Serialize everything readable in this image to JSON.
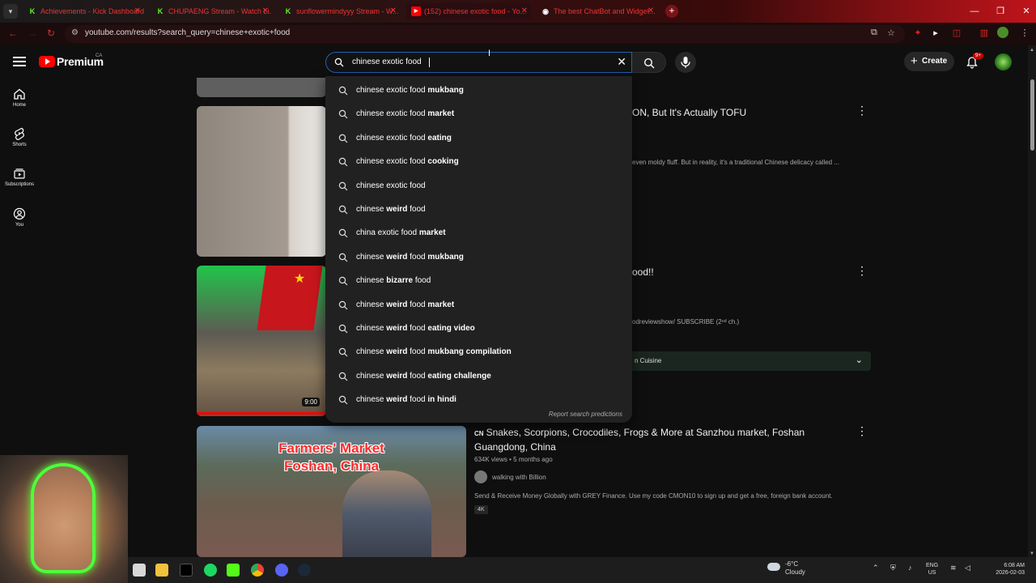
{
  "browser": {
    "tabs": [
      {
        "title": "Achievements - Kick Dashboard",
        "favicon": "kick-icon",
        "favicon_color": "#53fc18"
      },
      {
        "title": "CHUPAENG Stream - Watch Li...",
        "favicon": "kick-icon",
        "favicon_color": "#53fc18"
      },
      {
        "title": "sunflowermindyyy Stream - W...",
        "favicon": "kick-icon",
        "favicon_color": "#53fc18"
      },
      {
        "title": "(152) chinese exotic food - Yo...",
        "favicon": "youtube-icon",
        "favicon_color": "#ff0000"
      },
      {
        "title": "The best ChatBot and Widget...",
        "favicon": "botrix-icon",
        "favicon_color": "#ffffff"
      }
    ],
    "active_tab_index": 3,
    "url": "youtube.com/results?search_query=chinese+exotic+food"
  },
  "youtube": {
    "logo_text": "Premium",
    "country_code": "CA",
    "search_query": "chinese exotic food",
    "create_label": "Create",
    "notification_badge": "9+",
    "nav": [
      {
        "label": "Home",
        "icon": "home-icon"
      },
      {
        "label": "Shorts",
        "icon": "shorts-icon"
      },
      {
        "label": "Subscriptions",
        "icon": "subscriptions-icon"
      },
      {
        "label": "You",
        "icon": "you-icon"
      }
    ],
    "suggestions": [
      {
        "base": "chinese exotic food",
        "bold": " mukbang"
      },
      {
        "base": "chinese exotic food",
        "bold": " market"
      },
      {
        "base": "chinese exotic food",
        "bold": " eating"
      },
      {
        "base": "chinese exotic food",
        "bold": " cooking"
      },
      {
        "base": "chinese exotic food",
        "bold": ""
      },
      {
        "base": "chinese",
        "bold": " weird",
        "tail": " food"
      },
      {
        "base": "china",
        "bold": "",
        "tail": " exotic food",
        "bold2": " market"
      },
      {
        "base": "chinese",
        "bold": " weird",
        "tail": " food",
        "bold2": " mukbang"
      },
      {
        "base": "chinese",
        "bold": " bizarre",
        "tail": " food"
      },
      {
        "base": "chinese",
        "bold": " weird",
        "tail": " food",
        "bold2": " market"
      },
      {
        "base": "chinese",
        "bold": " weird",
        "tail": " food",
        "bold2": " eating video"
      },
      {
        "base": "chinese",
        "bold": " weird",
        "tail": " food",
        "bold2": " mukbang compilation"
      },
      {
        "base": "chinese",
        "bold": " weird",
        "tail": " food",
        "bold2": " eating challenge"
      },
      {
        "base": "chinese",
        "bold": " weird",
        "tail": " food",
        "bold2": " in hindi"
      }
    ],
    "report_label": "Report search predictions",
    "results": [
      {
        "title_visible": "ON, But It's Actually TOFU",
        "desc_visible": "even moldy fluff. But in reality, it's a traditional Chinese delicacy called ..."
      },
      {
        "title_visible": "ood!!",
        "desc_visible": "odreviewshow/ SUBSCRIBE (2ⁿᵈ ch.)",
        "duration": "9:00",
        "chapter_label": "n Cuisine"
      },
      {
        "country_badge": "CN",
        "title": "Snakes, Scorpions, Crocodiles, Frogs & More at Sanzhou market, Foshan Guangdong, China",
        "views": "634K views",
        "age": "5 months ago",
        "channel": "walking with Billion",
        "desc": "Send & Receive Money Globally with GREY Finance. Use my code CMON10 to sign up and get a free, foreign bank account.",
        "quality_badge": "4K",
        "thumb_text_1": "Farmers' Market",
        "thumb_text_2": "Foshan, China"
      }
    ]
  },
  "taskbar": {
    "weather_temp": "-6°C",
    "weather_desc": "Cloudy",
    "lang_1": "ENG",
    "lang_2": "US",
    "time": "6:08 AM",
    "date": "2026-02-03"
  }
}
